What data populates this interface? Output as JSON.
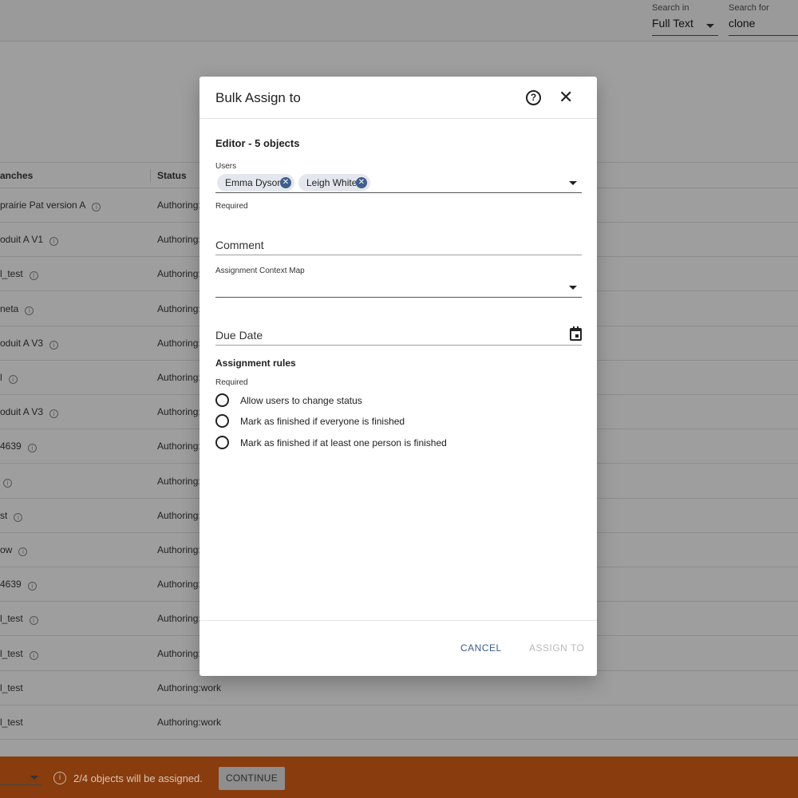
{
  "search": {
    "in_label": "Search in",
    "in_value": "Full Text",
    "for_label": "Search for",
    "for_value": "clone"
  },
  "table": {
    "columns": [
      "anches",
      "Status"
    ],
    "rows": [
      {
        "name": "prairie Pat version A",
        "status": "Authoring:"
      },
      {
        "name": "oduit A V1",
        "status": "Authoring:"
      },
      {
        "name": "l_test",
        "status": "Authoring:"
      },
      {
        "name": "neta",
        "status": "Authoring:"
      },
      {
        "name": "oduit A V3",
        "status": "Authoring:"
      },
      {
        "name": "l",
        "status": "Authoring:"
      },
      {
        "name": "oduit A V3",
        "status": "Authoring:"
      },
      {
        "name": "4639",
        "status": "Authoring:"
      },
      {
        "name": "",
        "status": "Authoring:"
      },
      {
        "name": "st",
        "status": "Authoring:"
      },
      {
        "name": "ow",
        "status": "Authoring:"
      },
      {
        "name": "4639",
        "status": "Authoring:"
      },
      {
        "name": "l_test",
        "status": "Authoring:"
      },
      {
        "name": "l_test",
        "status": "Authoring:"
      },
      {
        "name": "l_test",
        "status": "Authoring:work"
      },
      {
        "name": "l_test",
        "status": "Authoring:work"
      }
    ]
  },
  "bottom_bar": {
    "message": "2/4 objects will be assigned.",
    "continue_label": "CONTINUE",
    "bg_color": "#893c0d"
  },
  "dialog": {
    "title": "Bulk Assign to",
    "section_title": "Editor - 5 objects",
    "users_label": "Users",
    "users": [
      "Emma Dyson",
      "Leigh White"
    ],
    "users_helper": "Required",
    "comment_placeholder": "Comment",
    "context_map_label": "Assignment Context Map",
    "due_date_placeholder": "Due Date",
    "rules_title": "Assignment rules",
    "rules_helper": "Required",
    "rules": [
      "Allow users to change status",
      "Mark as finished if everyone is finished",
      "Mark as finished if at least one person is finished"
    ],
    "cancel_label": "CANCEL",
    "assign_label": "ASSIGN TO",
    "accent_color": "#3f5f8c"
  }
}
